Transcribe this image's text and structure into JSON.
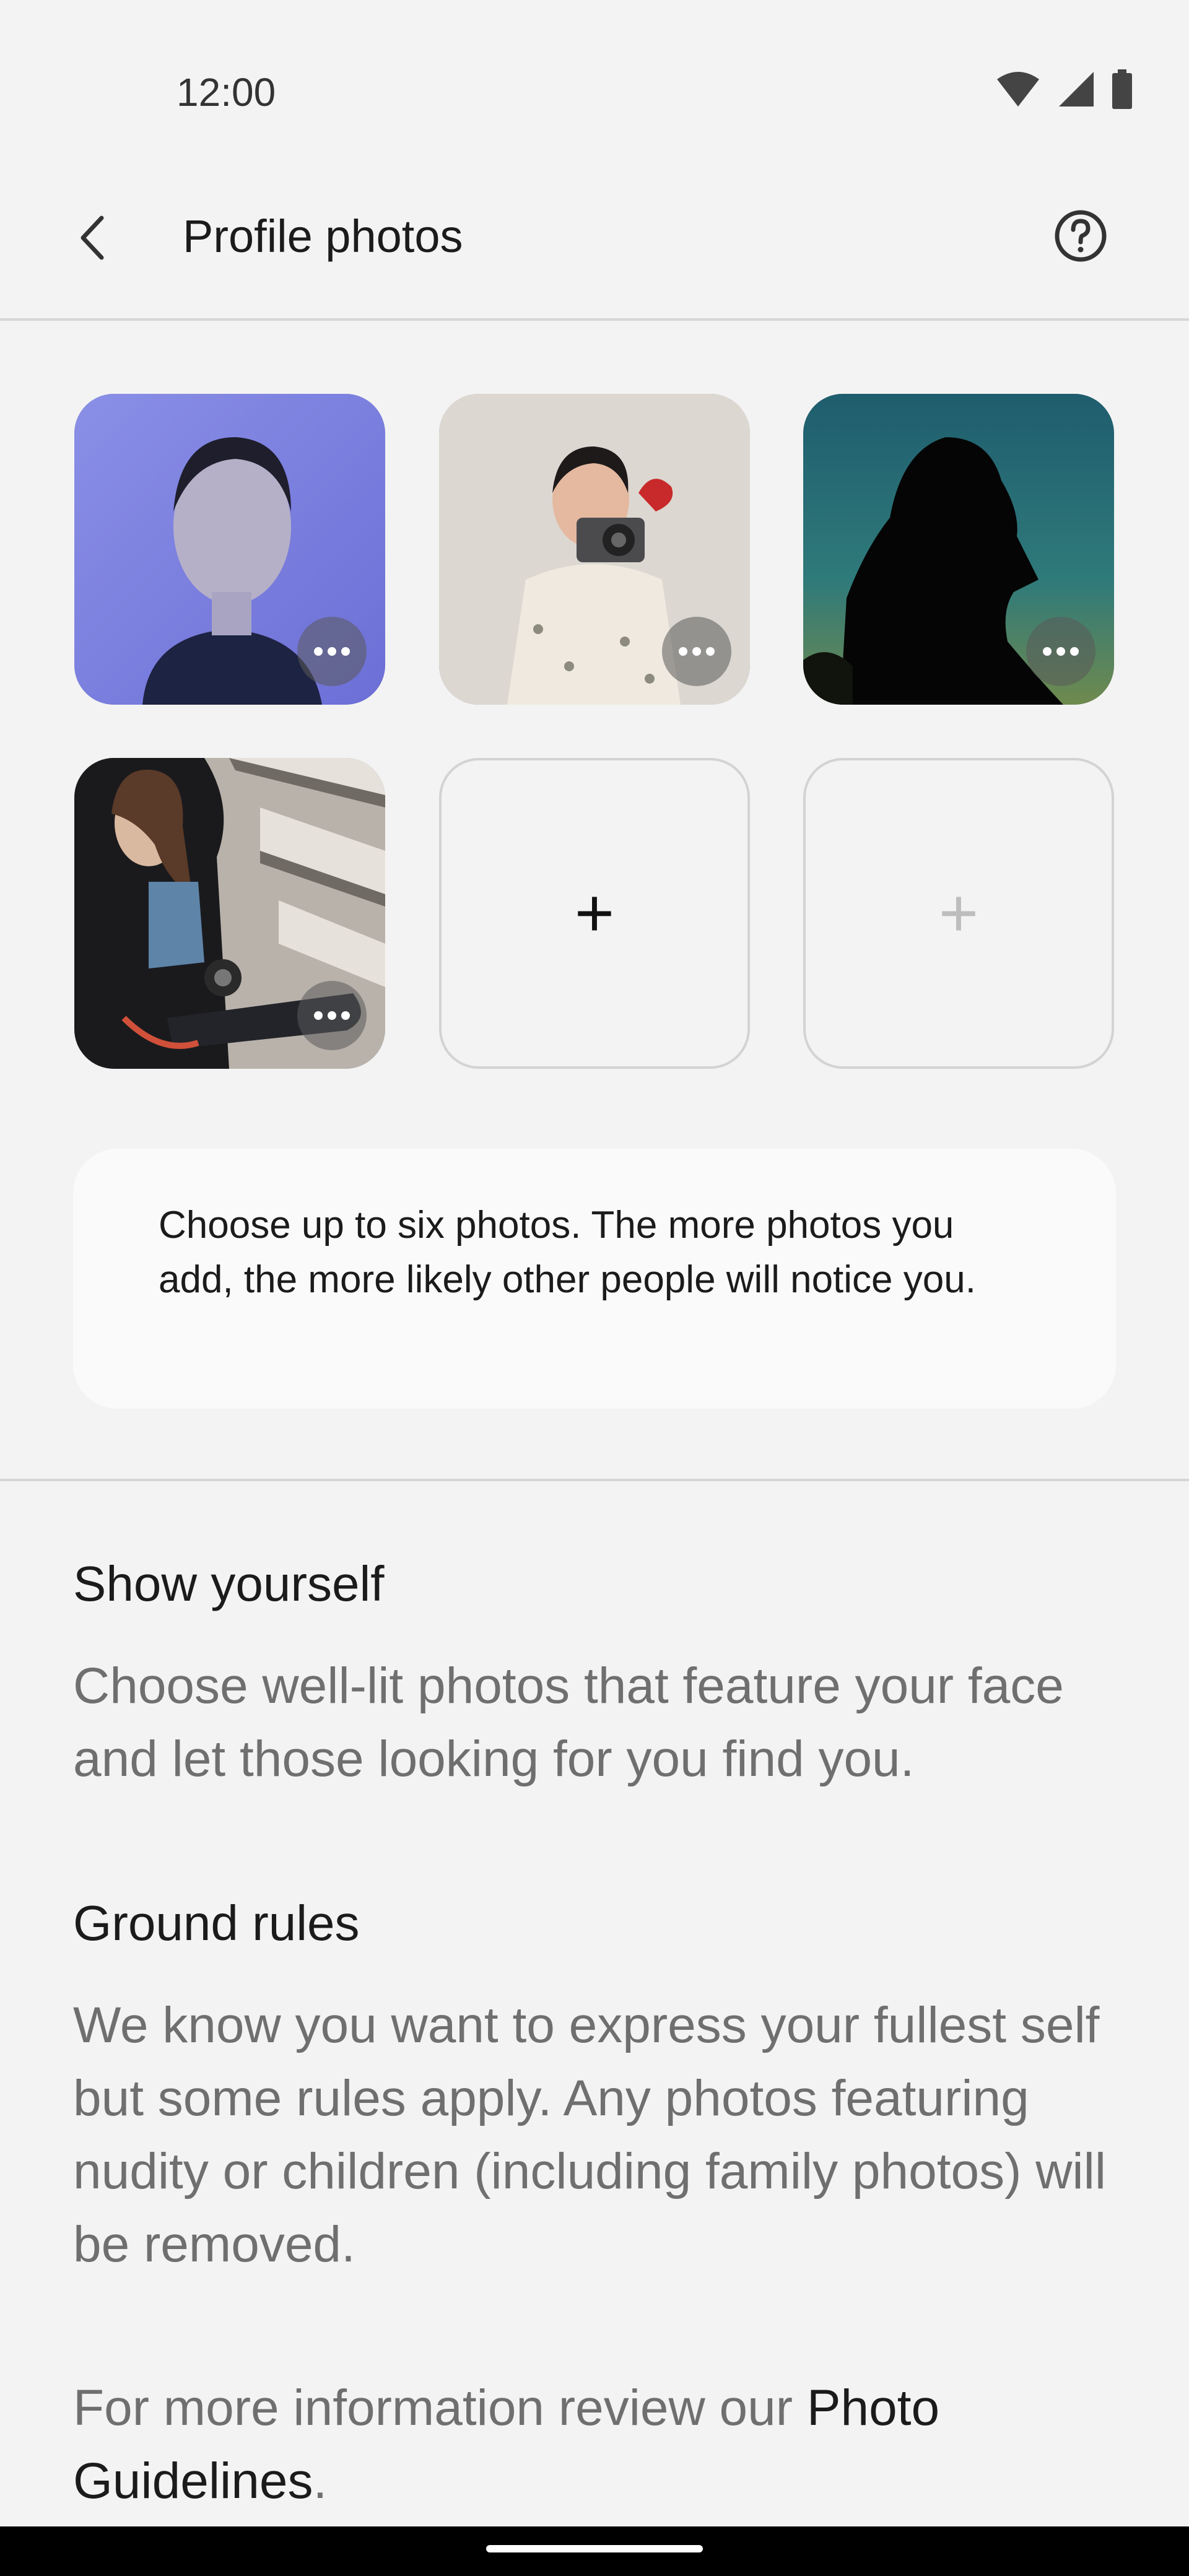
{
  "status_bar": {
    "time": "12:00",
    "icons": [
      "wifi-icon",
      "signal-icon",
      "battery-icon"
    ]
  },
  "app_bar": {
    "title": "Profile photos",
    "back_icon": "chevron-left-icon",
    "help_icon": "help-circle-icon"
  },
  "photos": [
    {
      "name": "photo-1",
      "has_more_menu": true
    },
    {
      "name": "photo-2",
      "has_more_menu": true
    },
    {
      "name": "photo-3",
      "has_more_menu": true
    },
    {
      "name": "photo-4",
      "has_more_menu": true
    },
    {
      "name": "add-photo-slot-1",
      "add_icon": "+",
      "state": "active"
    },
    {
      "name": "add-photo-slot-2",
      "add_icon": "+",
      "state": "inactive"
    }
  ],
  "info_card": {
    "text": "Choose up to six photos. The more photos you add, the more likely other people will notice you."
  },
  "sections": [
    {
      "heading": "Show yourself",
      "body": "Choose well-lit photos that feature your face and let those looking for you find you."
    },
    {
      "heading": "Ground rules",
      "body": "We know you want to express your fullest self but some rules apply. Any photos featuring nudity or children (including family photos) will be removed."
    }
  ],
  "footer": {
    "prefix": "For more information review our ",
    "link": "Photo Guidelines",
    "suffix": "."
  },
  "colors": {
    "background": "#f3f3f3",
    "text": "#1b1b1b",
    "muted": "#6f6f6f",
    "divider": "#d6d6d6"
  }
}
